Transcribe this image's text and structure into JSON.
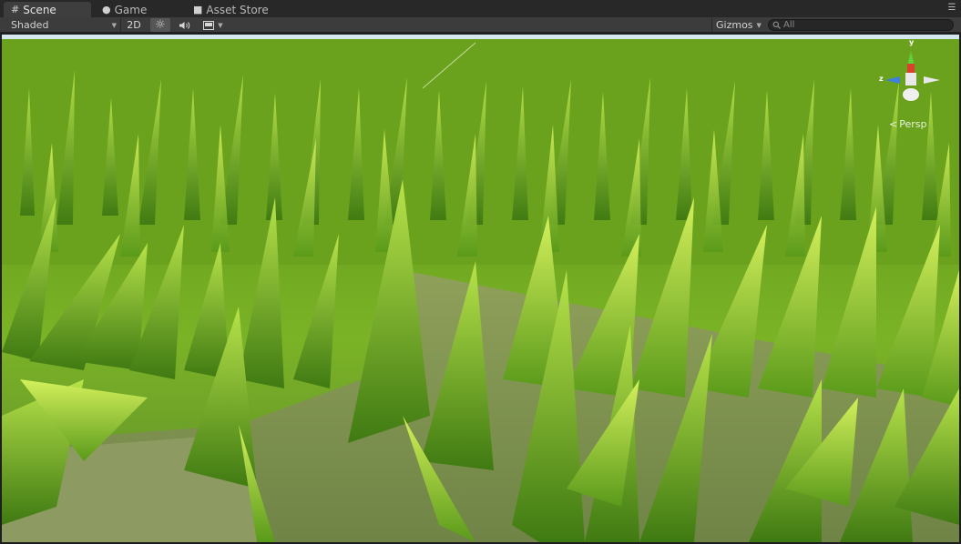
{
  "tabs": [
    {
      "label": "Scene",
      "icon": "scene-grid-icon",
      "active": true
    },
    {
      "label": "Game",
      "icon": "game-controller-icon",
      "active": false
    },
    {
      "label": "Asset Store",
      "icon": "lock-icon",
      "active": false
    }
  ],
  "toolbar": {
    "render_mode": "Shaded",
    "mode_2d_label": "2D",
    "lighting_icon": "sun-icon",
    "audio_icon": "speaker-icon",
    "effects_icon": "image-effects-icon",
    "gizmos_label": "Gizmos",
    "search_placeholder": "All"
  },
  "gizmo": {
    "y_label": "y",
    "z_label": "z",
    "projection_label": "Persp"
  },
  "colors": {
    "panel_bg": "#3c3c3c",
    "tab_active": "#3e3e3e",
    "axis_y": "#5fcf3c",
    "axis_z": "#3d7fe0",
    "axis_x": "#d9412e"
  }
}
